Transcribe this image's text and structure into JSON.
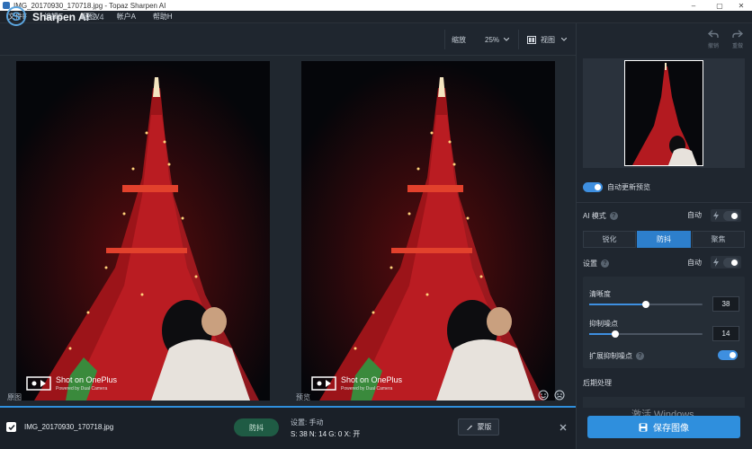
{
  "window": {
    "title": "IMG_20170930_170718.jpg - Topaz Sharpen AI",
    "minimize": "–",
    "restore": "▢",
    "close": "✕"
  },
  "menu": {
    "items": [
      "文件F",
      "编辑E",
      "视图V",
      "帐户A",
      "帮助H"
    ]
  },
  "header": {
    "brand_name": "Sharpen AI",
    "brand_version": "v2.2.4",
    "zoom_label": "缩放",
    "zoom_value": "25%",
    "view_label": "视图"
  },
  "viewer": {
    "left_caption": "原图",
    "right_caption": "预览",
    "watermark_title": "Shot on OnePlus",
    "watermark_sub": "Powered by Dual Camera"
  },
  "bottombar": {
    "filename": "IMG_20170930_170718.jpg",
    "mode_badge": "防抖",
    "settings_line1": "设置: 手动",
    "settings_line2": "S: 38  N: 14  G: 0  X: 开",
    "mask_button": "蒙版"
  },
  "right_panel": {
    "undo_label": "撤销",
    "redo_label": "重做",
    "auto_update_preview": "自动更新预览",
    "auto_update_on": true,
    "ai_mode_label": "AI 模式",
    "ai_mode_auto": "自动",
    "ai_mode_auto_on": false,
    "modes": [
      "锐化",
      "防抖",
      "聚焦"
    ],
    "active_mode": "防抖",
    "settings_label": "设置",
    "settings_auto": "自动",
    "settings_auto_on": false,
    "sharpness_label": "清晰度",
    "sharpness_value": "38",
    "sharpness_fraction": 0.5,
    "noise_label": "抑制噪点",
    "noise_value": "14",
    "noise_fraction": 0.23,
    "extend_noise_label": "扩展抑制噪点",
    "extend_noise_on": true,
    "post_processing_label": "后期处理",
    "save_button": "保存图像",
    "windows_watermark": "激活 Windows"
  },
  "colors": {
    "accent": "#3e8fe0",
    "brand": "#5ba5df",
    "tower_red": "#d4242a",
    "mode_badge_bg": "#1f5b44"
  }
}
